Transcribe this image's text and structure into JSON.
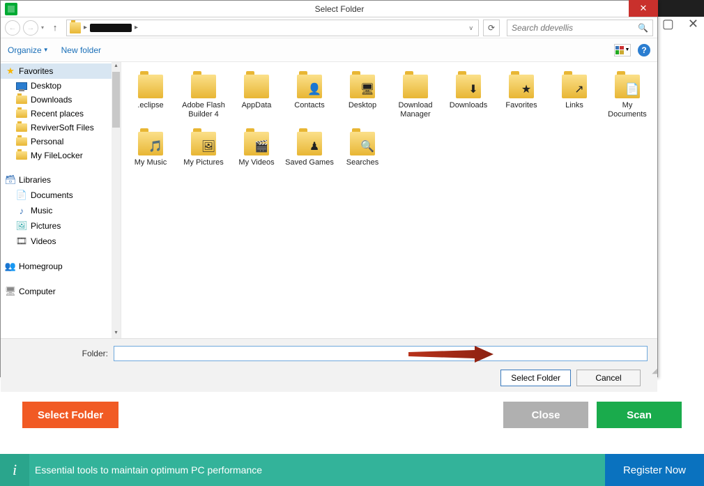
{
  "dialog": {
    "title": "Select Folder",
    "search_placeholder": "Search ddevellis",
    "organize": "Organize",
    "new_folder": "New folder",
    "folder_label": "Folder:",
    "folder_value": "",
    "select_btn": "Select Folder",
    "cancel_btn": "Cancel"
  },
  "sidebar": {
    "favorites": {
      "head": "Favorites",
      "items": [
        "Desktop",
        "Downloads",
        "Recent places",
        "ReviverSoft Files",
        "Personal",
        "My FileLocker"
      ]
    },
    "libraries": {
      "head": "Libraries",
      "items": [
        "Documents",
        "Music",
        "Pictures",
        "Videos"
      ]
    },
    "homegroup": "Homegroup",
    "computer": "Computer"
  },
  "folders": [
    {
      "name": ".eclipse",
      "overlay": ""
    },
    {
      "name": "Adobe Flash Builder 4",
      "overlay": ""
    },
    {
      "name": "AppData",
      "overlay": ""
    },
    {
      "name": "Contacts",
      "overlay": "👤"
    },
    {
      "name": "Desktop",
      "overlay": "🖥"
    },
    {
      "name": "Download Manager",
      "overlay": ""
    },
    {
      "name": "Downloads",
      "overlay": "⬇"
    },
    {
      "name": "Favorites",
      "overlay": "★"
    },
    {
      "name": "Links",
      "overlay": "↗"
    },
    {
      "name": "My Documents",
      "overlay": "📄"
    },
    {
      "name": "My Music",
      "overlay": "🎵"
    },
    {
      "name": "My Pictures",
      "overlay": "🖼"
    },
    {
      "name": "My Videos",
      "overlay": "🎬"
    },
    {
      "name": "Saved Games",
      "overlay": "♟"
    },
    {
      "name": "Searches",
      "overlay": "🔍"
    }
  ],
  "app": {
    "select_folder": "Select Folder",
    "close": "Close",
    "scan": "Scan"
  },
  "teal": {
    "msg": "Essential tools to maintain optimum PC performance",
    "register": "Register Now"
  }
}
